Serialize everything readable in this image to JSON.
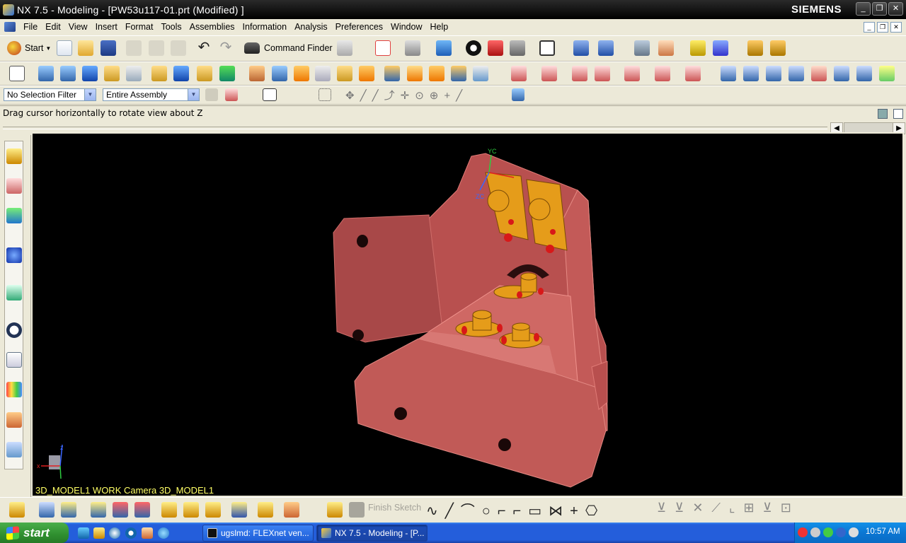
{
  "window": {
    "title": "NX 7.5 - Modeling - [PW53u117-01.prt (Modified) ]",
    "brand": "SIEMENS"
  },
  "menu": [
    "File",
    "Edit",
    "View",
    "Insert",
    "Format",
    "Tools",
    "Assemblies",
    "Information",
    "Analysis",
    "Preferences",
    "Window",
    "Help"
  ],
  "toolbar": {
    "start_label": "Start",
    "command_finder_label": "Command Finder"
  },
  "selection": {
    "filter": "No Selection Filter",
    "scope": "Entire Assembly"
  },
  "cue_line": "Drag cursor horizontally to rotate view about Z",
  "viewport": {
    "label": "3D_MODEL1 WORK Camera 3D_MODEL1",
    "csys_labels": {
      "yc": "YC",
      "zc": "ZC",
      "x": "x",
      "z": "z"
    },
    "colors": {
      "background": "#000000",
      "part": "#c85a5a",
      "part_dark": "#8e3a3a",
      "fasteners": "#e59c1a",
      "pins": "#d81818"
    }
  },
  "sketch_toolbar": {
    "finish_sketch": "Finish Sketch"
  },
  "taskbar": {
    "start": "start",
    "tasks": [
      "ugslmd:  FLEXnet ven...",
      "NX 7.5 - Modeling - [P..."
    ],
    "clock": "10:57 AM"
  }
}
